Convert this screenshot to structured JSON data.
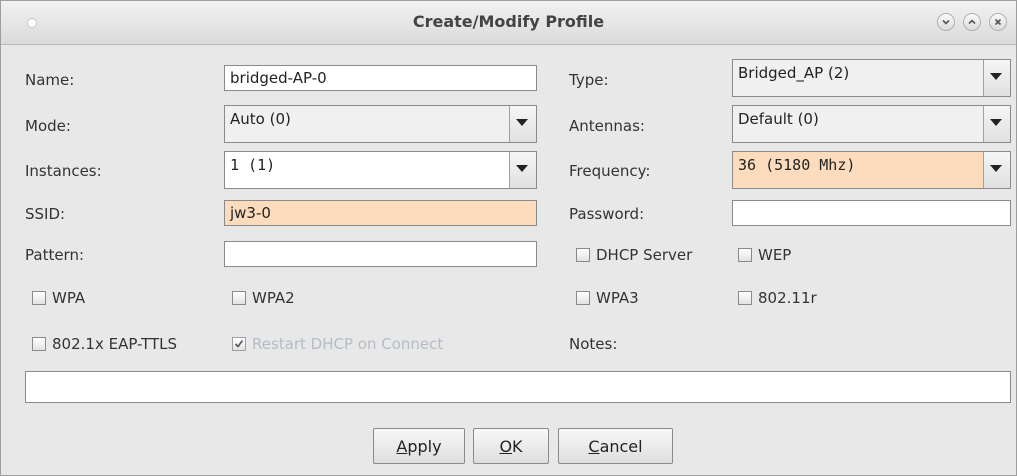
{
  "window": {
    "title": "Create/Modify Profile"
  },
  "form": {
    "name_label": "Name:",
    "name_value": "bridged-AP-0",
    "type_label": "Type:",
    "type_value": "Bridged_AP (2)",
    "mode_label": "Mode:",
    "mode_value": "Auto (0)",
    "antennas_label": "Antennas:",
    "antennas_value": "Default (0)",
    "instances_label": "Instances:",
    "instances_value": "1 (1)",
    "frequency_label": "Frequency:",
    "frequency_value": "36 (5180 Mhz)",
    "ssid_label": "SSID:",
    "ssid_value": "jw3-0",
    "password_label": "Password:",
    "password_value": "",
    "pattern_label": "Pattern:",
    "pattern_value": "",
    "notes_label": "Notes:",
    "notes_value": ""
  },
  "checkboxes": {
    "dhcp_server": {
      "label": "DHCP Server",
      "checked": false
    },
    "wep": {
      "label": "WEP",
      "checked": false
    },
    "wpa": {
      "label": "WPA",
      "checked": false
    },
    "wpa2": {
      "label": "WPA2",
      "checked": false
    },
    "wpa3": {
      "label": "WPA3",
      "checked": false
    },
    "ieee80211r": {
      "label": "802.11r",
      "checked": false
    },
    "eap_ttls": {
      "label": "802.1x EAP-TTLS",
      "checked": false
    },
    "restart_dhcp": {
      "label": "Restart DHCP on Connect",
      "checked": true,
      "disabled": true
    }
  },
  "buttons": {
    "apply": {
      "mnemonic": "A",
      "rest": "pply"
    },
    "ok": {
      "mnemonic": "O",
      "rest": "K"
    },
    "cancel": {
      "mnemonic": "C",
      "rest": "ancel"
    }
  },
  "colors": {
    "highlight": "#fcdcbc",
    "disabled_text": "#b4bcc8"
  }
}
